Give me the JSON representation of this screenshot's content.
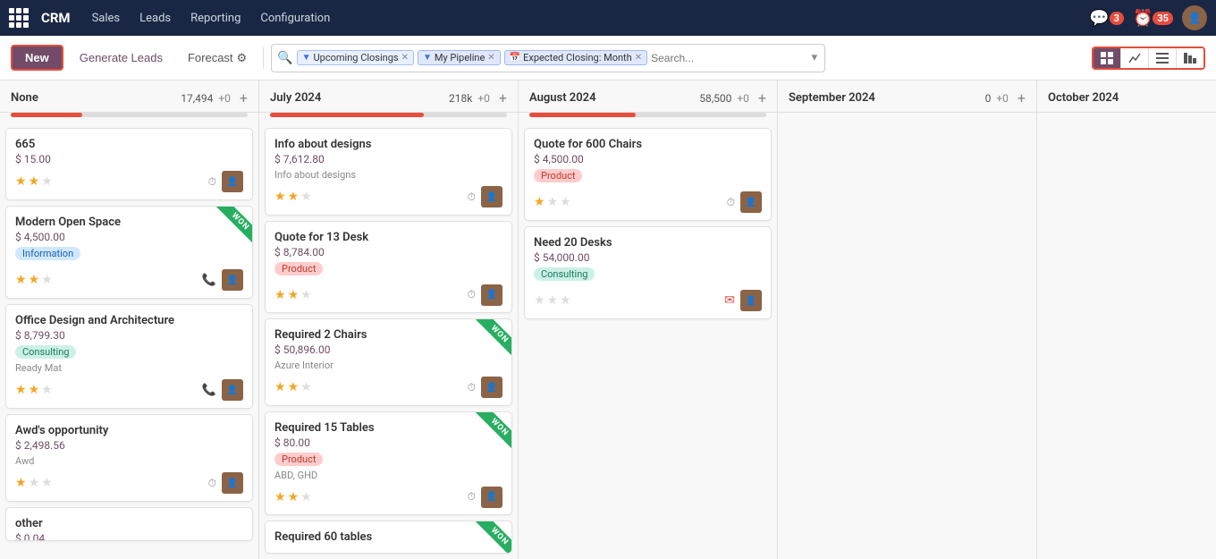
{
  "app": {
    "title": "CRM"
  },
  "topnav": {
    "app_label": "CRM",
    "items": [
      {
        "label": "Sales",
        "id": "sales"
      },
      {
        "label": "Leads",
        "id": "leads"
      },
      {
        "label": "Reporting",
        "id": "reporting"
      },
      {
        "label": "Configuration",
        "id": "configuration"
      }
    ],
    "notif_count": "3",
    "timer_count": "35"
  },
  "toolbar": {
    "new_label": "New",
    "generate_leads_label": "Generate Leads",
    "forecast_label": "Forecast",
    "filters": [
      {
        "label": "Upcoming Closings",
        "type": "funnel"
      },
      {
        "label": "My Pipeline",
        "type": "funnel2"
      },
      {
        "label": "Expected Closing: Month",
        "type": "calendar"
      }
    ],
    "search_placeholder": "Search...",
    "view_buttons": [
      {
        "label": "▦",
        "id": "kanban",
        "active": true
      },
      {
        "label": "📈",
        "id": "graph"
      },
      {
        "label": "☰",
        "id": "list"
      },
      {
        "label": "≡",
        "id": "activity"
      }
    ]
  },
  "columns": [
    {
      "id": "none",
      "title": "None",
      "amount": "17,494",
      "delta": "+0",
      "progress": 30,
      "cards": [
        {
          "id": "c1",
          "title": "665",
          "amount": "$ 15.00",
          "tag": null,
          "subtitle": null,
          "stars": 2,
          "icon": "clock",
          "won": false
        },
        {
          "id": "c2",
          "title": "Modern Open Space",
          "amount": "$ 4,500.00",
          "tag": "Information",
          "tag_type": "information",
          "subtitle": null,
          "stars": 2,
          "icon": "phone",
          "won": true
        },
        {
          "id": "c3",
          "title": "Office Design and Architecture",
          "amount": "$ 8,799.30",
          "tag": "Consulting",
          "tag_type": "consulting",
          "subtitle": "Ready Mat",
          "stars": 2,
          "icon": "phone",
          "won": false
        },
        {
          "id": "c4",
          "title": "Awd's opportunity",
          "amount": "$ 2,498.56",
          "tag": null,
          "subtitle": "Awd",
          "stars": 1,
          "icon": "clock",
          "won": false
        },
        {
          "id": "c5",
          "title": "other",
          "amount": "$ 0.04",
          "tag": null,
          "subtitle": null,
          "stars": 0,
          "icon": null,
          "won": false,
          "partial": true
        }
      ]
    },
    {
      "id": "july2024",
      "title": "July 2024",
      "amount": "218k",
      "delta": "+0",
      "progress": 65,
      "cards": [
        {
          "id": "j1",
          "title": "Info about designs",
          "amount": "$ 7,612.80",
          "tag": null,
          "subtitle": "Info about designs",
          "stars": 2,
          "icon": "clock",
          "won": false
        },
        {
          "id": "j2",
          "title": "Quote for 13 Desk",
          "amount": "$ 8,784.00",
          "tag": "Product",
          "tag_type": "product",
          "subtitle": null,
          "stars": 2,
          "icon": "clock",
          "won": false
        },
        {
          "id": "j3",
          "title": "Required 2 Chairs",
          "amount": "$ 50,896.00",
          "tag": null,
          "subtitle": "Azure Interior",
          "stars": 2,
          "icon": "clock",
          "won": true
        },
        {
          "id": "j4",
          "title": "Required 15 Tables",
          "amount": "$ 80.00",
          "tag": "Product",
          "tag_type": "product",
          "subtitle": "ABD, GHD",
          "stars": 2,
          "icon": "clock",
          "won": true
        },
        {
          "id": "j5",
          "title": "Required 60 tables",
          "amount": "",
          "tag": null,
          "subtitle": null,
          "stars": 0,
          "icon": null,
          "won": true,
          "partial": true
        }
      ]
    },
    {
      "id": "aug2024",
      "title": "August 2024",
      "amount": "58,500",
      "delta": "+0",
      "progress": 45,
      "cards": [
        {
          "id": "a1",
          "title": "Quote for 600 Chairs",
          "amount": "$ 4,500.00",
          "tag": "Product",
          "tag_type": "product",
          "subtitle": null,
          "stars": 1,
          "icon": "clock",
          "won": false
        },
        {
          "id": "a2",
          "title": "Need 20 Desks",
          "amount": "$ 54,000.00",
          "tag": "Consulting",
          "tag_type": "consulting",
          "subtitle": null,
          "stars": 0,
          "icon": "mail",
          "won": false
        }
      ]
    },
    {
      "id": "sep2024",
      "title": "September 2024",
      "amount": "0",
      "delta": "+0",
      "progress": 0,
      "cards": []
    },
    {
      "id": "oct2024",
      "title": "October 2024",
      "amount": "",
      "delta": "",
      "progress": 0,
      "cards": []
    }
  ]
}
